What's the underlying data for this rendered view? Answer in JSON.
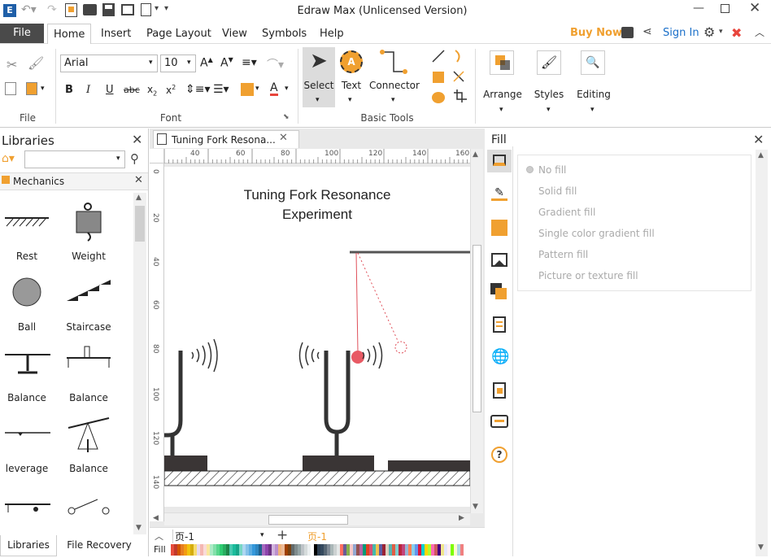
{
  "window": {
    "title": "Edraw Max (Unlicensed Version)"
  },
  "menu": {
    "file": "File",
    "tabs": [
      "Home",
      "Insert",
      "Page Layout",
      "View",
      "Symbols",
      "Help"
    ],
    "buy_now": "Buy Now",
    "sign_in": "Sign In"
  },
  "ribbon": {
    "file_group": "File",
    "font_family": "Arial",
    "font_size": "10",
    "font_group": "Font",
    "select": "Select",
    "text": "Text",
    "connector": "Connector",
    "basic_tools": "Basic Tools",
    "arrange": "Arrange",
    "styles": "Styles",
    "editing": "Editing"
  },
  "libraries": {
    "title": "Libraries",
    "search_value": "",
    "category": "Mechanics",
    "items": [
      "Rest",
      "Weight",
      "Ball",
      "Staircase",
      "Balance",
      "Balance",
      "leverage",
      "Balance",
      "",
      ""
    ],
    "bottom_tabs": [
      "Libraries",
      "File Recovery"
    ]
  },
  "document": {
    "tab_name": "Tuning Fork Resona...",
    "title_line1": "Tuning Fork Resonance",
    "title_line2": "Experiment",
    "ruler_h": [
      "40",
      "60",
      "80",
      "100",
      "120",
      "140",
      "160"
    ],
    "ruler_v": [
      "0",
      "20",
      "40",
      "60",
      "80",
      "100",
      "120",
      "140"
    ]
  },
  "status": {
    "page_select": "页-1",
    "page_tab": "页-1",
    "fill_label": "Fill"
  },
  "fill": {
    "title": "Fill",
    "options": [
      "No fill",
      "Solid fill",
      "Gradient fill",
      "Single color gradient fill",
      "Pattern fill",
      "Picture or texture fill"
    ]
  },
  "colors": {
    "accent": "#f0a030",
    "brand_red": "#e8453c",
    "ribbon_select": "#dcdcdc",
    "file_tab": "#4a4a4a"
  },
  "palette": [
    "#e74c3c",
    "#c0392b",
    "#d35400",
    "#e67e22",
    "#f39c12",
    "#f1c40f",
    "#d4ac0d",
    "#f7dc6f",
    "#e8daef",
    "#f5b7b1",
    "#fadbd8",
    "#f9e79f",
    "#abebc6",
    "#82e0aa",
    "#58d68d",
    "#2ecc71",
    "#27ae60",
    "#1e8449",
    "#48c9b0",
    "#1abc9c",
    "#17a589",
    "#76d7c4",
    "#aed6f1",
    "#85c1e9",
    "#5dade2",
    "#3498db",
    "#2e86c1",
    "#1f618d",
    "#a569bd",
    "#8e44ad",
    "#6c3483",
    "#d2b4de",
    "#bb8fce",
    "#f0b27a",
    "#edbb99",
    "#a04000",
    "#784212",
    "#616a6b",
    "#7f8c8d",
    "#95a5a6",
    "#bdc3c7",
    "#d5dbdb",
    "#ecf0f1",
    "#ffffff",
    "#000000",
    "#2c3e50",
    "#34495e",
    "#566573",
    "#808b96",
    "#aab7b8",
    "#ccd1d1",
    "#e5e8e8",
    "#ff6f61",
    "#6b5b95",
    "#88b04b",
    "#f7cac9",
    "#92a8d1",
    "#955251",
    "#b565a7",
    "#009b77",
    "#dd4124",
    "#d65076",
    "#45b8ac",
    "#efc050",
    "#5b5ea6",
    "#9b2335",
    "#dfcfbe",
    "#55b4b0",
    "#e15d44",
    "#7fcdcd",
    "#bc243c",
    "#c3447a",
    "#98b4d4",
    "#ff7f50",
    "#87ceeb",
    "#6495ed",
    "#dc143c",
    "#00ced1",
    "#ffd700",
    "#adff2f",
    "#ff69b4",
    "#cd5c5c",
    "#4b0082",
    "#f0e68c",
    "#e6e6fa",
    "#fff0f5",
    "#7cfc00",
    "#fffacd",
    "#add8e6",
    "#f08080"
  ]
}
